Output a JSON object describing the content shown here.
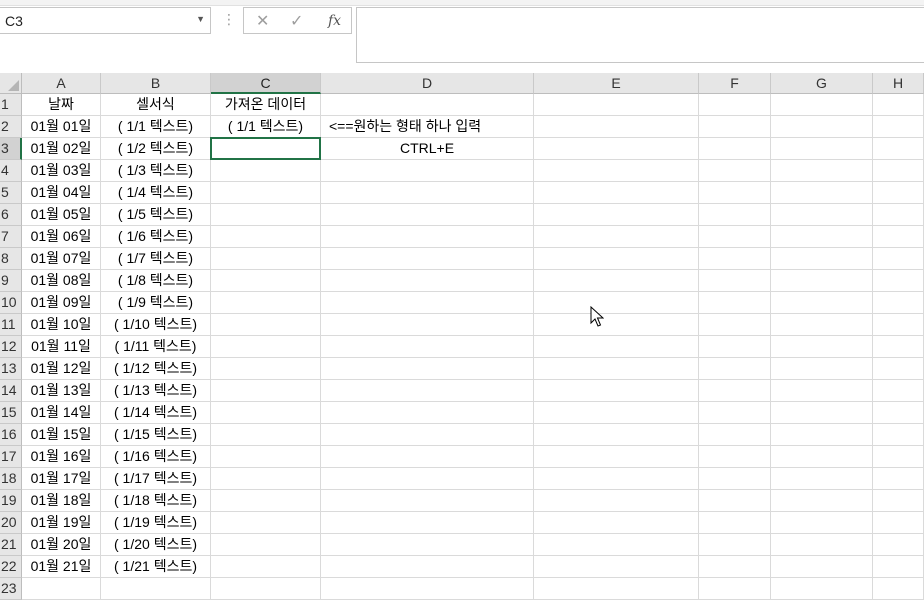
{
  "name_box": {
    "value": "C3"
  },
  "formula_bar": {
    "value": "",
    "cancel_glyph": "✕",
    "enter_glyph": "✓",
    "fx_label": "fx"
  },
  "columns": [
    {
      "label": "A",
      "width": 79
    },
    {
      "label": "B",
      "width": 110
    },
    {
      "label": "C",
      "width": 110
    },
    {
      "label": "D",
      "width": 213
    },
    {
      "label": "E",
      "width": 165
    },
    {
      "label": "F",
      "width": 72
    },
    {
      "label": "G",
      "width": 102
    },
    {
      "label": "H",
      "width": 51
    }
  ],
  "selected": {
    "col": "C",
    "row": 3
  },
  "rows": [
    {
      "n": "1",
      "cells": {
        "A": "날짜",
        "B": "셀서식",
        "C": "가져온 데이터"
      }
    },
    {
      "n": "2",
      "cells": {
        "A": "01월 01일",
        "B": "( 1/1 텍스트)",
        "C": "( 1/1 텍스트)",
        "D": "<==원하는 형태 하나 입력"
      }
    },
    {
      "n": "3",
      "cells": {
        "A": "01월 02일",
        "B": "( 1/2 텍스트)",
        "D": "CTRL+E"
      }
    },
    {
      "n": "4",
      "cells": {
        "A": "01월 03일",
        "B": "( 1/3 텍스트)"
      }
    },
    {
      "n": "5",
      "cells": {
        "A": "01월 04일",
        "B": "( 1/4 텍스트)"
      }
    },
    {
      "n": "6",
      "cells": {
        "A": "01월 05일",
        "B": "( 1/5 텍스트)"
      }
    },
    {
      "n": "7",
      "cells": {
        "A": "01월 06일",
        "B": "( 1/6 텍스트)"
      }
    },
    {
      "n": "8",
      "cells": {
        "A": "01월 07일",
        "B": "( 1/7 텍스트)"
      }
    },
    {
      "n": "9",
      "cells": {
        "A": "01월 08일",
        "B": "( 1/8 텍스트)"
      }
    },
    {
      "n": "10",
      "cells": {
        "A": "01월 09일",
        "B": "( 1/9 텍스트)"
      }
    },
    {
      "n": "11",
      "cells": {
        "A": "01월 10일",
        "B": "( 1/10 텍스트)"
      }
    },
    {
      "n": "12",
      "cells": {
        "A": "01월 11일",
        "B": "( 1/11 텍스트)"
      }
    },
    {
      "n": "13",
      "cells": {
        "A": "01월 12일",
        "B": "( 1/12 텍스트)"
      }
    },
    {
      "n": "14",
      "cells": {
        "A": "01월 13일",
        "B": "( 1/13 텍스트)"
      }
    },
    {
      "n": "15",
      "cells": {
        "A": "01월 14일",
        "B": "( 1/14 텍스트)"
      }
    },
    {
      "n": "16",
      "cells": {
        "A": "01월 15일",
        "B": "( 1/15 텍스트)"
      }
    },
    {
      "n": "17",
      "cells": {
        "A": "01월 16일",
        "B": "( 1/16 텍스트)"
      }
    },
    {
      "n": "18",
      "cells": {
        "A": "01월 17일",
        "B": "( 1/17 텍스트)"
      }
    },
    {
      "n": "19",
      "cells": {
        "A": "01월 18일",
        "B": "( 1/18 텍스트)"
      }
    },
    {
      "n": "20",
      "cells": {
        "A": "01월 19일",
        "B": "( 1/19 텍스트)"
      }
    },
    {
      "n": "21",
      "cells": {
        "A": "01월 20일",
        "B": "( 1/20 텍스트)"
      }
    },
    {
      "n": "22",
      "cells": {
        "A": "01월 21일",
        "B": "( 1/21 텍스트)"
      }
    },
    {
      "n": "23",
      "cells": {}
    }
  ]
}
